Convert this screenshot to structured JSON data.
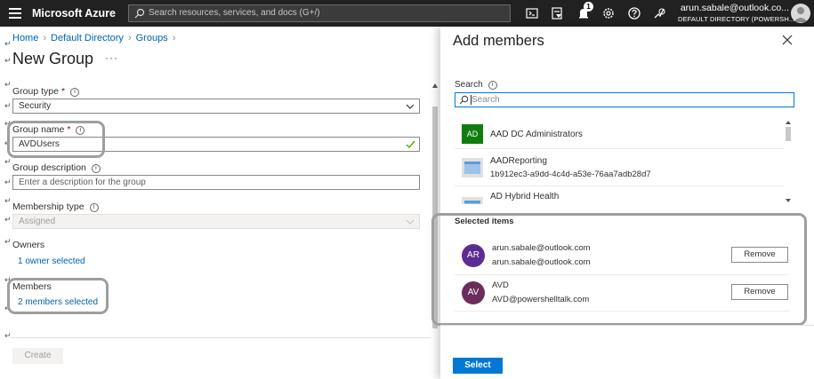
{
  "topbar": {
    "brand": "Microsoft Azure",
    "search_placeholder": "Search resources, services, and docs (G+/)",
    "notification_count": "1",
    "account_email": "arun.sabale@outlook.co...",
    "account_directory": "DEFAULT DIRECTORY (POWERSH..."
  },
  "left": {
    "breadcrumb": [
      "Home",
      "Default Directory",
      "Groups"
    ],
    "page_title": "New Group",
    "title_more": "···",
    "group_type_label": "Group type",
    "group_type_value": "Security",
    "group_name_label": "Group name",
    "group_name_value": "AVDUsers",
    "group_description_label": "Group description",
    "group_description_placeholder": "Enter a description for the group",
    "membership_type_label": "Membership type",
    "membership_type_value": "Assigned",
    "owners_label": "Owners",
    "owners_link": "1 owner selected",
    "members_label": "Members",
    "members_link": "2 members selected",
    "create_button": "Create",
    "required_mark": "*",
    "info_mark": "i",
    "paragraph_mark": "↵"
  },
  "blade": {
    "title": "Add members",
    "search_label": "Search",
    "search_placeholder": "Search",
    "results": [
      {
        "initials": "AD",
        "name": "AAD DC Administrators",
        "sub": ""
      },
      {
        "initials": "",
        "name": "AADReporting",
        "sub": "1b912ec3-a9dd-4c4d-a53e-76aa7adb28d7"
      },
      {
        "initials": "",
        "name": "AD Hybrid Health",
        "sub": ""
      }
    ],
    "selected_heading": "Selected items",
    "selected": [
      {
        "initials": "AR",
        "line1": "arun.sabale@outlook.com",
        "line2": "arun.sabale@outlook.com",
        "remove": "Remove",
        "color": "#5c2d91"
      },
      {
        "initials": "AV",
        "line1": "AVD",
        "line2": "AVD@powershelltalk.com",
        "remove": "Remove",
        "color": "#6b2d5c"
      }
    ],
    "select_button": "Select"
  },
  "colors": {
    "topbar": "#212121",
    "link": "#0063b1",
    "primary": "#0078d4",
    "highlight_ring": "#9e9e9e",
    "group_tile_green": "#107c10"
  },
  "icons": {
    "menu": "hamburger-icon",
    "search": "search-icon",
    "cloud_shell": "cloud-shell-icon",
    "directory_filter": "directory-filter-icon",
    "notifications": "bell-icon",
    "settings": "gear-icon",
    "help": "help-icon",
    "feedback": "feedback-icon",
    "close": "close-icon",
    "dropdown": "chevron-down-icon",
    "valid": "checkmark-icon"
  }
}
